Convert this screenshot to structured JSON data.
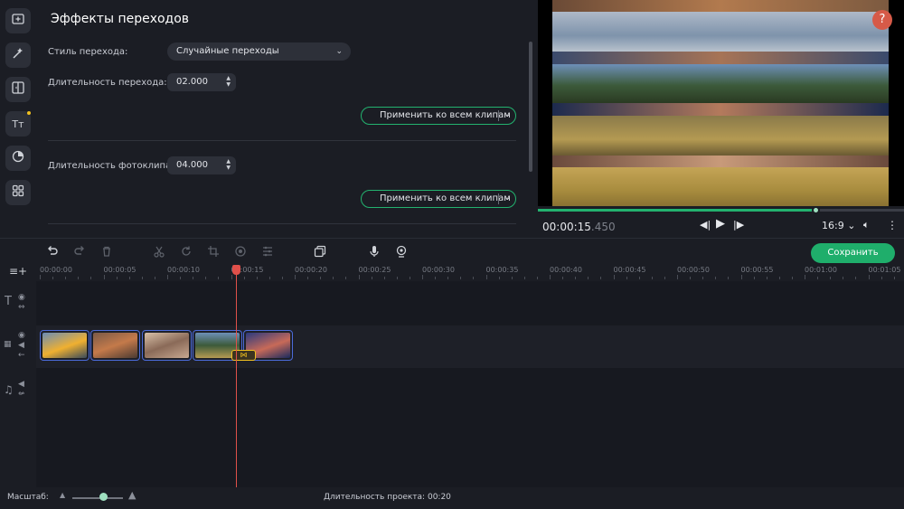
{
  "panel": {
    "title": "Эффекты переходов",
    "transition_style_label": "Стиль перехода:",
    "transition_style_value": "Случайные переходы",
    "transition_duration_label": "Длительность перехода:",
    "transition_duration_value": "02.000",
    "apply_all_label_1": "Применить ко всем клипам",
    "photo_duration_label": "Длительность фотоклипа:",
    "photo_duration_value": "04.000",
    "apply_all_label_2": "Применить ко всем клипам"
  },
  "rail": {
    "icons": [
      "import-icon",
      "magic-wand-icon",
      "transitions-icon",
      "titles-icon",
      "filters-icon",
      "more-tools-icon"
    ]
  },
  "preview": {
    "help": "?",
    "timecode_main": "00:00:15",
    "timecode_ms": ".450",
    "aspect_ratio": "16:9",
    "progress": 0.76
  },
  "toolbar": {
    "save_label": "Сохранить",
    "icons": [
      "undo-icon",
      "redo-icon",
      "delete-icon",
      "cut-icon",
      "rotate-icon",
      "crop-icon",
      "color-icon",
      "adjust-icon",
      "clip-properties-icon",
      "microphone-icon",
      "webcam-icon"
    ]
  },
  "timeline": {
    "ruler": [
      "00:00:00",
      "00:00:05",
      "00:00:10",
      "00:00:15",
      "00:00:20",
      "00:00:25",
      "00:00:30",
      "00:00:35",
      "00:00:40",
      "00:00:45",
      "00:00:50",
      "00:00:55",
      "00:01:00",
      "00:01:05"
    ],
    "playhead_time": "00:00:15",
    "transition_symbol": "⋈"
  },
  "footer": {
    "zoom_label": "Масштаб:",
    "duration_label": "Длительность проекта:",
    "duration_value": "00:20",
    "zoom_level": 0.6
  },
  "colors": {
    "accent": "#1fae6b",
    "playhead": "#e0504a",
    "clip_border": "#4b6ad8",
    "transition": "#f0c020"
  }
}
